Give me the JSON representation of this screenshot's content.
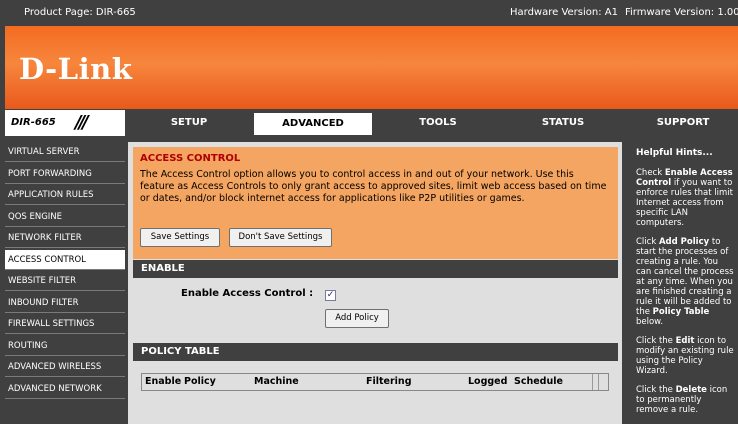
{
  "topbar": {
    "product": "Product Page: DIR-665",
    "hardware": "Hardware Version: A1",
    "firmware": "Firmware Version: 1.00"
  },
  "brand": {
    "logo": "D-Link"
  },
  "model": "DIR-665",
  "nav_tabs": [
    "SETUP",
    "ADVANCED",
    "TOOLS",
    "STATUS",
    "SUPPORT"
  ],
  "sidebar": {
    "items": [
      "VIRTUAL SERVER",
      "PORT FORWARDING",
      "APPLICATION RULES",
      "QOS ENGINE",
      "NETWORK FILTER",
      "ACCESS CONTROL",
      "WEBSITE FILTER",
      "INBOUND FILTER",
      "FIREWALL SETTINGS",
      "ROUTING",
      "ADVANCED WIRELESS",
      "ADVANCED NETWORK"
    ]
  },
  "access_control": {
    "heading": "ACCESS CONTROL",
    "description": "The Access Control option allows you to control access in and out of your network. Use this feature as Access Controls to only grant access to approved sites, limit web access based on time or dates, and/or block internet access for applications like P2P utilities or games.",
    "save_label": "Save Settings",
    "dont_save_label": "Don't Save Settings"
  },
  "enable_section": {
    "heading": "ENABLE",
    "label": "Enable Access Control :",
    "checked": true,
    "add_policy_label": "Add Policy"
  },
  "policy_table": {
    "heading": "POLICY TABLE",
    "columns": [
      "Enable",
      "Policy",
      "Machine",
      "Filtering",
      "Logged",
      "Schedule"
    ]
  },
  "hints": {
    "title": "Helpful Hints...",
    "p1_pre": "Check ",
    "p1_bold": "Enable Access Control",
    "p1_post": " if you want to enforce rules that limit Internet access from specific LAN computers.",
    "p2_pre": "Click ",
    "p2_bold": "Add Policy",
    "p2_post": " to start the processes of creating a rule. You can cancel the process at any time. When you are finished creating a rule it will be added to the ",
    "p2_bold2": "Policy Table",
    "p2_post2": " below.",
    "p3_pre": "Click the ",
    "p3_bold": "Edit",
    "p3_post": " icon to modify an existing rule using the Policy Wizard.",
    "p4_pre": "Click the ",
    "p4_bold": "Delete",
    "p4_post": " icon to permanently remove a rule."
  },
  "colors": {
    "accent_orange": "#f36b21",
    "panel_orange": "#f4a561",
    "dark_gray": "#404040",
    "heading_red": "#b00000"
  }
}
